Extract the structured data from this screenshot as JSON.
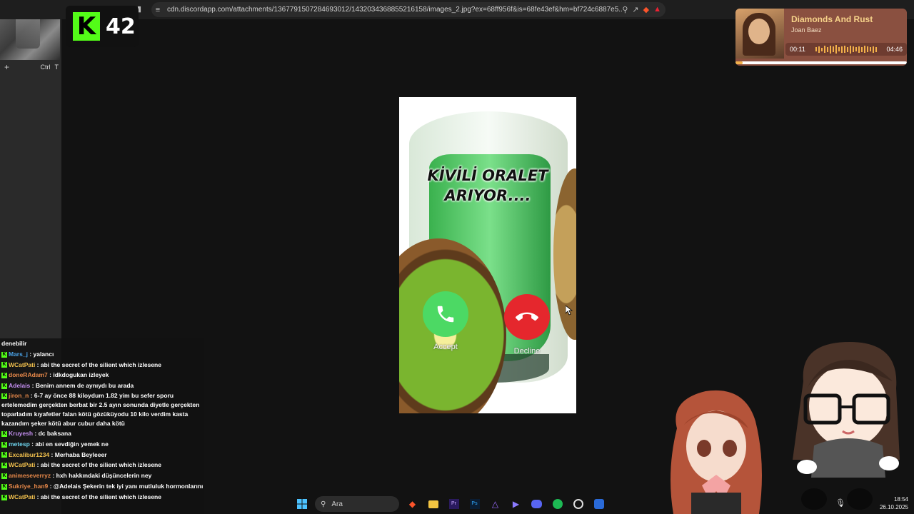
{
  "browser": {
    "url": "cdn.discordapp.com/attachments/1367791507284693012/1432034368855216158/images_2.jpg?ex=68ff956f&is=68fe43ef&hm=bf724c6887e5...",
    "new_tab_ctrl": "Ctrl",
    "new_tab_key": "T"
  },
  "kick_badge": {
    "count": "42"
  },
  "music": {
    "title": "Diamonds And Rust",
    "artist": "Joan Baez",
    "elapsed": "00:11",
    "duration": "04:46",
    "progress": 0.04,
    "accent": "#f3b14a"
  },
  "call": {
    "caller_text_line1": "KİVİLİ ORALET",
    "caller_text_line2": "ARIYOR....",
    "accept_label": "Accept",
    "decline_label": "Decline"
  },
  "chat": {
    "messages": [
      {
        "user": "",
        "text": "denebilir"
      },
      {
        "user": "Mars_j",
        "text": "yalancı",
        "color": "#4aa3e8"
      },
      {
        "user": "WCatPati",
        "text": "abi the secret of the silient which izlesene",
        "color": "#f2c14e"
      },
      {
        "user": "doneRAdam7",
        "text": "idkdogukan izleyek",
        "color": "#e8894a"
      },
      {
        "user": "Adelais",
        "text": "Benim annem de aynıydı bu arada",
        "color": "#c38ef0"
      },
      {
        "user": "jiron_n",
        "text": "6-7 ay önce 88 kiloydum 1.82 yim bu sefer sporu ertelemedim gerçekten berbat bir 2.5 ayın sonunda diyetle gerçekten toparladım kıyafetler falan kötü gözüküyodu 10 kilo verdim kasta kazandım şeker kötü abur cubur daha kötü",
        "color": "#e8894a"
      },
      {
        "user": "Kruyesh",
        "text": "dc baksana",
        "color": "#c38ef0"
      },
      {
        "user": "metesp",
        "text": "abi en sevdiğin yemek ne",
        "color": "#6fd6f0"
      },
      {
        "user": "Excalibur1234",
        "text": "Merhaba Beyleeer",
        "color": "#f2c14e"
      },
      {
        "user": "WCatPati",
        "text": "abi the secret of the silient which izlesene",
        "color": "#f2c14e"
      },
      {
        "user": "animeseverryz",
        "text": "hxh hakkındaki düşüncelerin ney",
        "color": "#e8894a"
      },
      {
        "user": "Sukriye_han9",
        "text": "@Adelais Şekerin tek iyi yanı mutluluk hormonlarını arttırmasıdır",
        "color": "#e8894a"
      },
      {
        "user": "WCatPati",
        "text": "abi the secret of the silient which izlesene",
        "color": "#f2c14e"
      }
    ]
  },
  "taskbar": {
    "search_placeholder": "Ara",
    "time": "18:54",
    "date": "26.10.2025"
  }
}
